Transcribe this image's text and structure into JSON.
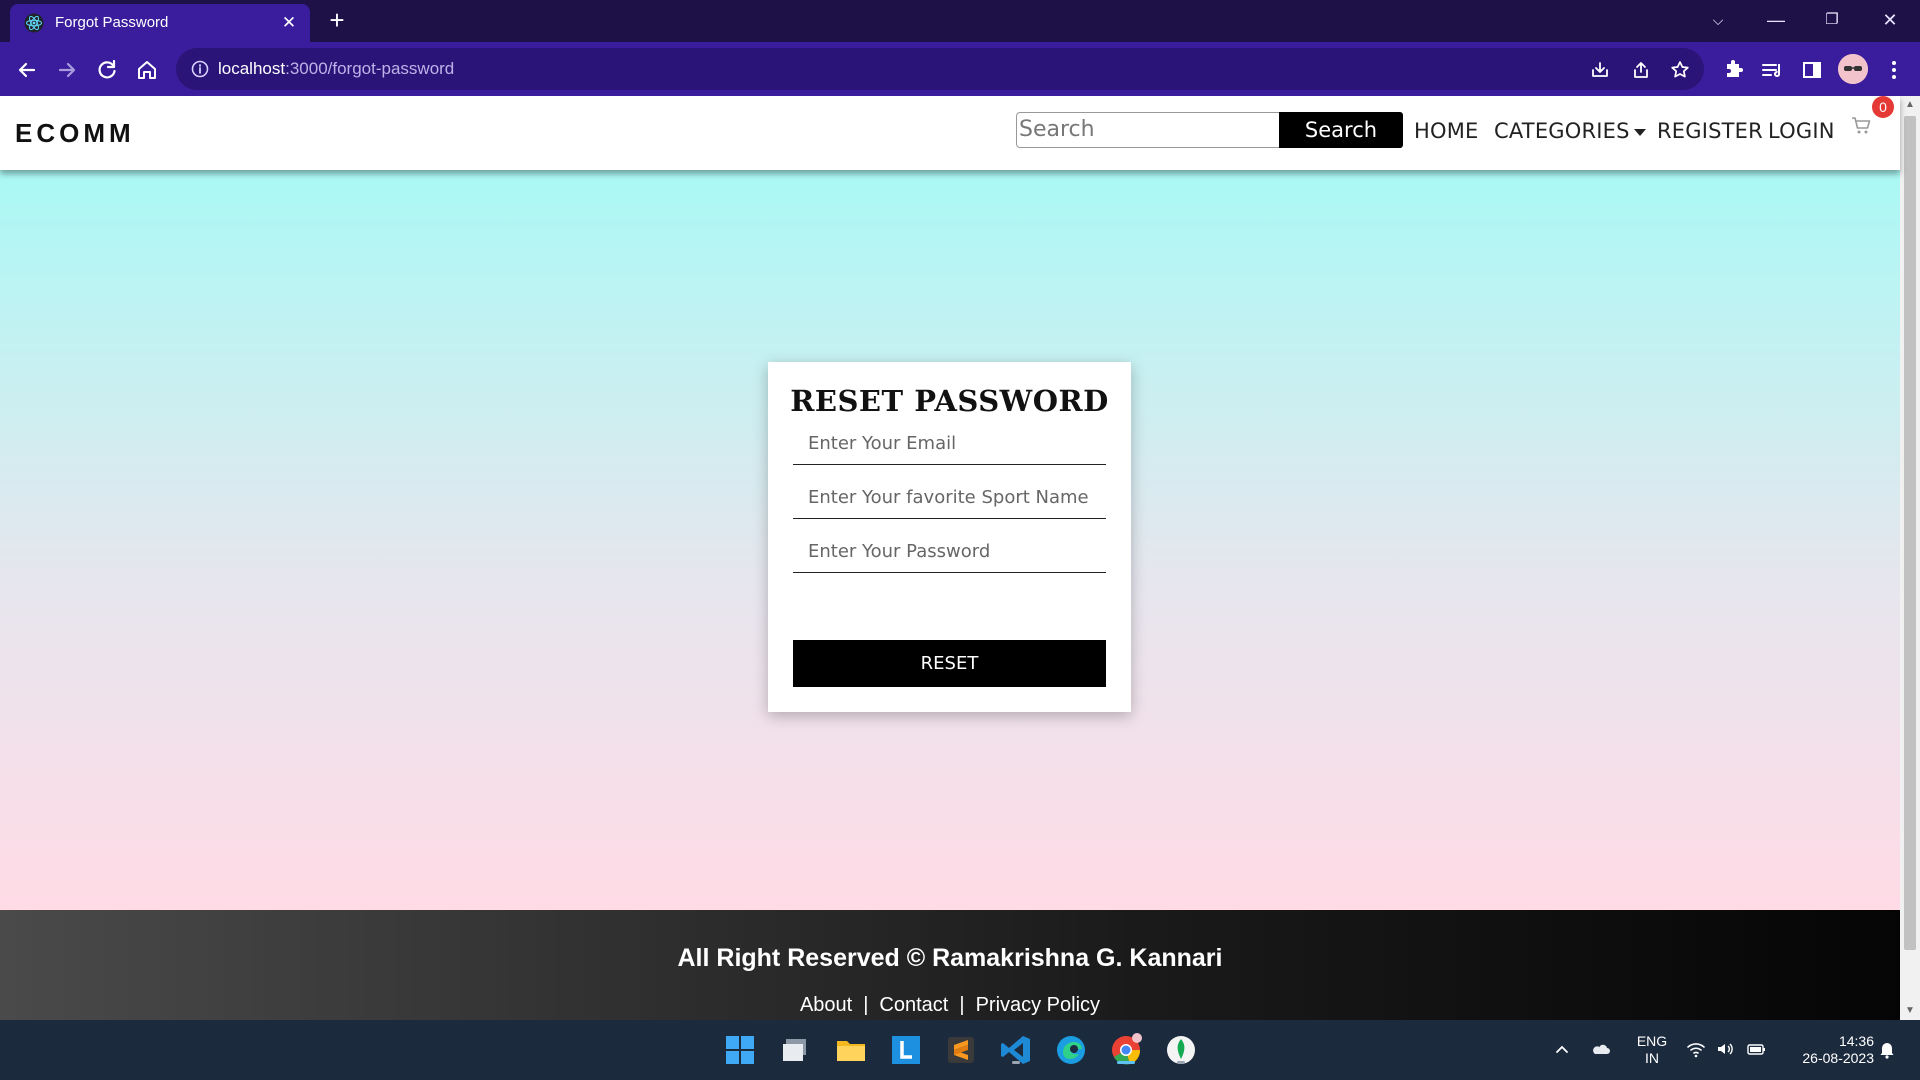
{
  "browser": {
    "tab_title": "Forgot Password",
    "url_host": "localhost",
    "url_path": ":3000/forgot-password"
  },
  "site": {
    "brand": "ECOMM",
    "search_placeholder": "Search",
    "search_button": "Search",
    "nav": {
      "home": "HOME",
      "categories": "CATEGORIES",
      "register": "REGISTER",
      "login": "LOGIN"
    },
    "cart_count": "0"
  },
  "form": {
    "title": "RESET PASSWORD",
    "email_placeholder": "Enter Your Email",
    "sport_placeholder": "Enter Your favorite Sport Name",
    "password_placeholder": "Enter Your Password",
    "submit": "RESET"
  },
  "footer": {
    "copyright": "All Right Reserved © Ramakrishna G. Kannari",
    "links": {
      "about": "About",
      "contact": "Contact",
      "privacy": "Privacy Policy"
    },
    "separator": "|"
  },
  "taskbar": {
    "language": "ENG",
    "region": "IN",
    "time": "14:36",
    "date": "26-08-2023"
  },
  "colors": {
    "browser_frame": "#1e1148",
    "browser_toolbar": "#3a1d9c",
    "gradient_top": "#aaf9f5",
    "gradient_bottom": "#ffdbe6",
    "badge": "#e53935"
  }
}
